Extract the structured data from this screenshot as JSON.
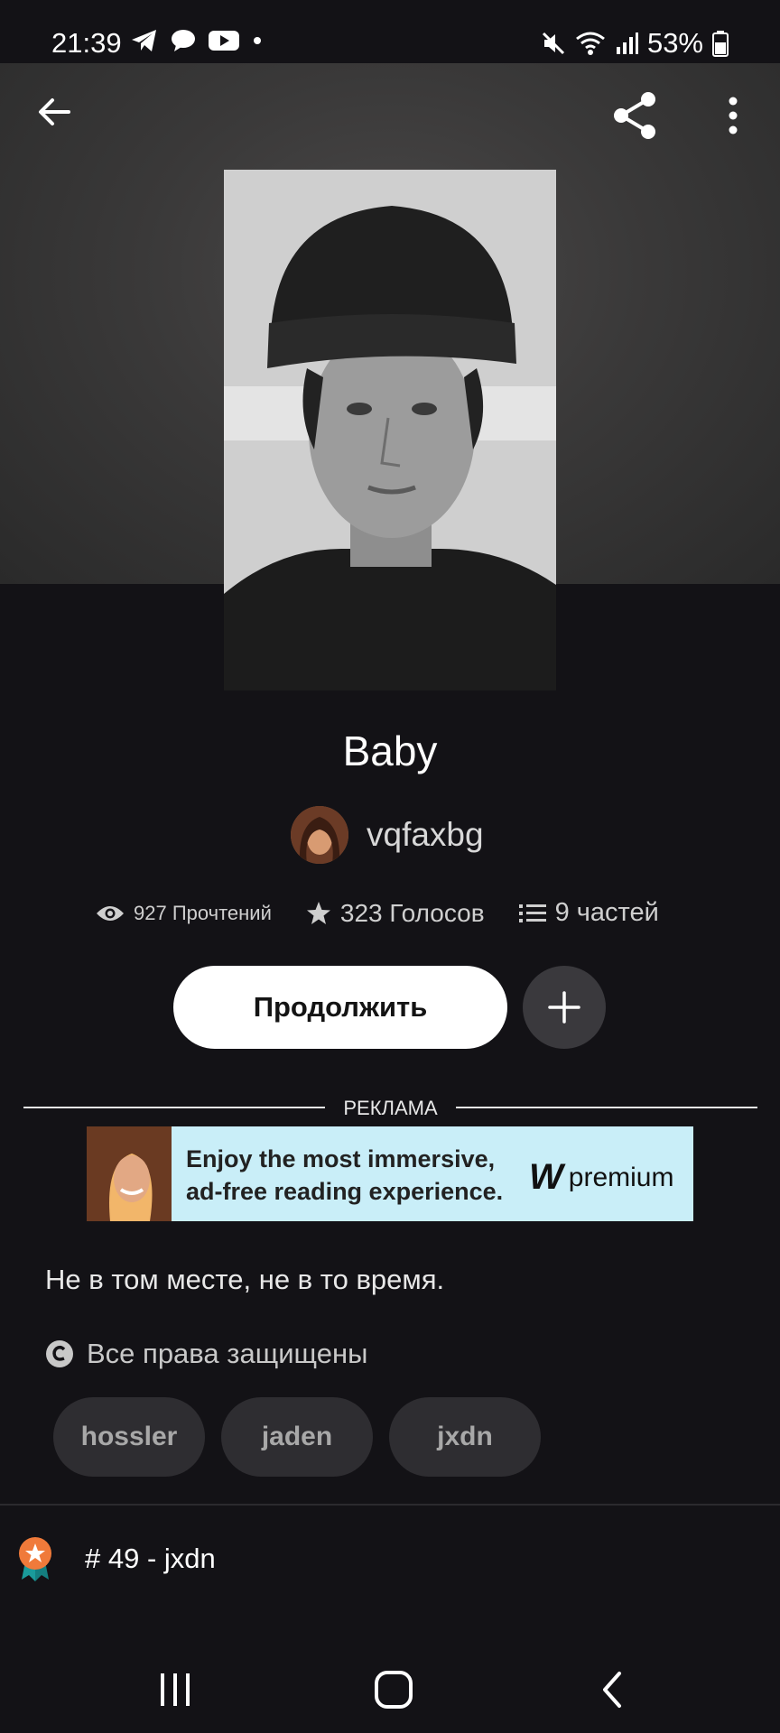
{
  "status_bar": {
    "time": "21:39",
    "battery": "53%",
    "icons": [
      "telegram-icon",
      "chat-bubble-icon",
      "youtube-icon",
      "dot-icon",
      "mute-icon",
      "wifi-icon",
      "signal-icon",
      "battery-icon"
    ]
  },
  "header": {
    "icons": [
      "back-arrow-icon",
      "share-icon",
      "more-vert-icon"
    ]
  },
  "story": {
    "title": "Baby",
    "author": "vqfaxbg",
    "reads": "927 Прочтений",
    "votes": "323 Голосов",
    "parts": "9 частей",
    "continue_label": "Продолжить",
    "description": "Не в том месте, не в то время.",
    "rights": "Все права защищены"
  },
  "ad": {
    "label": "РЕКЛАМА",
    "line1": "Enjoy the most immersive,",
    "line2": "ad-free reading experience.",
    "brand": "premium",
    "brand_mark": "W",
    "background": "#c9eef8"
  },
  "tags": [
    "hossler",
    "jaden",
    "jxdn"
  ],
  "rank": {
    "text": "# 49 - jxdn"
  },
  "colors": {
    "background": "#131216",
    "button": "#ffffff",
    "chip": "#2e2d31",
    "rank_badge": "#f07a3a"
  }
}
